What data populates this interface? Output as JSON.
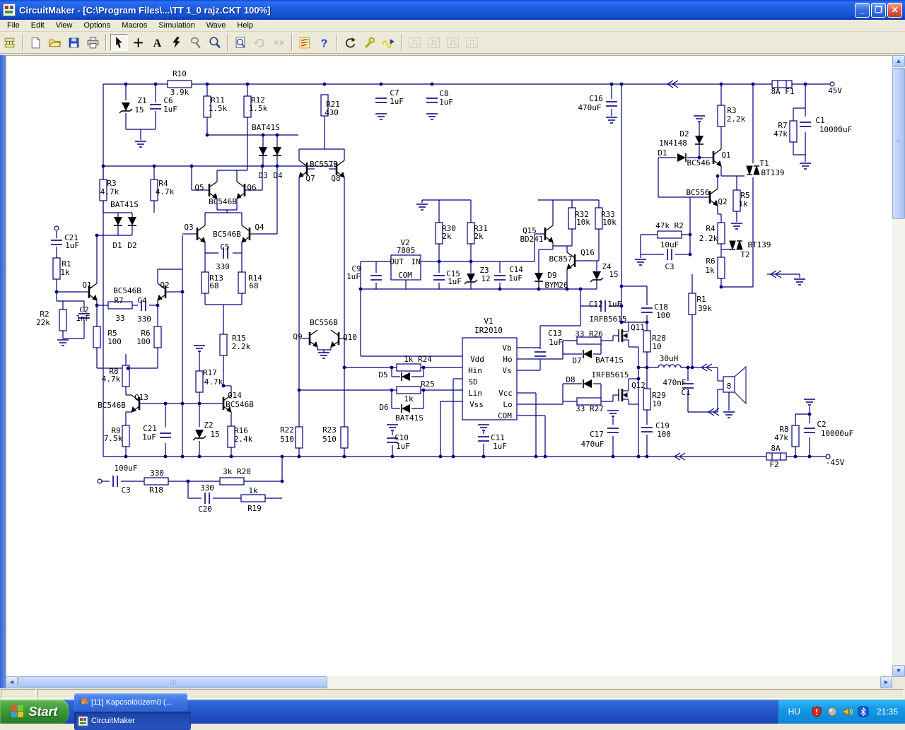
{
  "window": {
    "title": "CircuitMaker - [C:\\Program Files\\...\\TT 1_0  rajz.CKT 100%]"
  },
  "titlebar": {
    "minimize": "minimize-button",
    "restore": "restore-button",
    "close": "close-button"
  },
  "menu": {
    "items": [
      "File",
      "Edit",
      "View",
      "Options",
      "Macros",
      "Simulation",
      "Wave",
      "Help"
    ]
  },
  "toolbar": {
    "groups": [
      [
        {
          "n": "parts-bin"
        }
      ],
      [
        {
          "n": "new"
        },
        {
          "n": "open"
        },
        {
          "n": "save"
        },
        {
          "n": "print"
        }
      ],
      [
        {
          "n": "select",
          "pressed": true
        },
        {
          "n": "wire"
        },
        {
          "n": "text"
        },
        {
          "n": "delete"
        },
        {
          "n": "probe"
        },
        {
          "n": "zoom"
        }
      ],
      [
        {
          "n": "zoom-window"
        },
        {
          "n": "rotate",
          "disabled": true
        },
        {
          "n": "mirror",
          "disabled": true
        }
      ],
      [
        {
          "n": "simulation-setup"
        },
        {
          "n": "help"
        }
      ],
      [
        {
          "n": "reset"
        },
        {
          "n": "tools"
        },
        {
          "n": "waveforms"
        }
      ],
      [
        {
          "n": "digital-display-1",
          "disabled": true
        },
        {
          "n": "digital-display-2",
          "disabled": true
        },
        {
          "n": "digital-display-3",
          "disabled": true
        },
        {
          "n": "digital-display-4",
          "disabled": true
        }
      ]
    ]
  },
  "schematic": {
    "wire_color": "#00007e",
    "labels": [
      [
        "R10",
        253,
        103
      ],
      [
        "3.9k",
        253,
        129
      ],
      [
        "Z1",
        200,
        141
      ],
      [
        "15",
        196,
        154
      ],
      [
        "C6",
        237,
        141
      ],
      [
        "1uF",
        240,
        153
      ],
      [
        "R11",
        307,
        140
      ],
      [
        "1.5k",
        307,
        152
      ],
      [
        "R12",
        364,
        140
      ],
      [
        "1.5k",
        364,
        152
      ],
      [
        "BAT41S",
        375,
        179
      ],
      [
        "D3",
        371,
        247
      ],
      [
        "D4",
        392,
        247
      ],
      [
        "BC557B",
        457,
        231
      ],
      [
        "Q7",
        438,
        251
      ],
      [
        "Q8",
        474,
        251
      ],
      [
        "R21",
        470,
        146
      ],
      [
        "430",
        468,
        158
      ],
      [
        "C7",
        557,
        130
      ],
      [
        "1uF",
        560,
        142
      ],
      [
        "C8",
        627,
        131
      ],
      [
        "1uF",
        630,
        143
      ],
      [
        "C16",
        842,
        138
      ],
      [
        "470uF",
        833,
        151
      ],
      [
        "8A F1",
        1106,
        128
      ],
      [
        "45V",
        1180,
        127
      ],
      [
        "R3",
        1034,
        155
      ],
      [
        "2.2k",
        1040,
        167
      ],
      [
        "R7",
        1106,
        176
      ],
      [
        "47k",
        1103,
        188
      ],
      [
        "C1",
        1159,
        169
      ],
      [
        "10000uF",
        1181,
        182
      ],
      [
        "D2",
        967,
        188
      ],
      [
        "1N4148",
        951,
        201
      ],
      [
        "D1",
        936,
        215
      ],
      [
        "Q1",
        1026,
        218
      ],
      [
        "BC546",
        987,
        229
      ],
      [
        "T1",
        1080,
        230
      ],
      [
        "BT139",
        1092,
        243
      ],
      [
        "BC556",
        986,
        271
      ],
      [
        "Q2",
        1021,
        284
      ],
      [
        "R5",
        1053,
        275
      ],
      [
        "1k",
        1050,
        287
      ],
      [
        "47k R2",
        946,
        318
      ],
      [
        "10uF",
        946,
        345
      ],
      [
        "C3",
        946,
        376
      ],
      [
        "R4",
        1004,
        322
      ],
      [
        "2.2k",
        1001,
        336
      ],
      [
        "R6",
        1004,
        368
      ],
      [
        "1k",
        1003,
        381
      ],
      [
        "BT139",
        1073,
        345
      ],
      [
        "T2",
        1053,
        359
      ],
      [
        "R32",
        822,
        302
      ],
      [
        "10k",
        824,
        313
      ],
      [
        "R33",
        859,
        302
      ],
      [
        "10k",
        861,
        313
      ],
      [
        "Q15",
        748,
        325
      ],
      [
        "BD241",
        751,
        337
      ],
      [
        "BC857",
        792,
        365
      ],
      [
        "Q16",
        830,
        356
      ],
      [
        "Z4",
        857,
        376
      ],
      [
        "15",
        867,
        387
      ],
      [
        "D9",
        780,
        388
      ],
      [
        "BYM26",
        786,
        402
      ],
      [
        "V2",
        572,
        342
      ],
      [
        "7805",
        573,
        353
      ],
      [
        "OUT",
        560,
        369
      ],
      [
        "IN",
        587,
        369
      ],
      [
        "COM",
        572,
        388
      ],
      [
        "C9",
        503,
        379
      ],
      [
        "1uF",
        499,
        390
      ],
      [
        "R30",
        634,
        322
      ],
      [
        "2k",
        631,
        333
      ],
      [
        "R31",
        679,
        322
      ],
      [
        "2k",
        676,
        333
      ],
      [
        "C15",
        640,
        386
      ],
      [
        "1uF",
        642,
        397
      ],
      [
        "Z3",
        684,
        381
      ],
      [
        "12",
        686,
        393
      ],
      [
        "C14",
        729,
        380
      ],
      [
        "1uF",
        728,
        392
      ],
      [
        "C12 1uF",
        855,
        429
      ],
      [
        "V1",
        690,
        453
      ],
      [
        "IR2010",
        690,
        466
      ],
      [
        "Vdd",
        674,
        507
      ],
      [
        "Hin",
        671,
        523
      ],
      [
        "SD",
        668,
        539
      ],
      [
        "Lin",
        671,
        555
      ],
      [
        "Vss",
        673,
        571
      ],
      [
        "Vb",
        716,
        491
      ],
      [
        "Ho",
        717,
        507
      ],
      [
        "Vs",
        716,
        523
      ],
      [
        "Vcc",
        714,
        555
      ],
      [
        "Lo",
        717,
        571
      ],
      [
        "COM",
        713,
        587
      ],
      [
        "1k R24",
        590,
        507
      ],
      [
        "D5",
        541,
        529
      ],
      [
        "R25",
        604,
        542
      ],
      [
        "1k",
        577,
        563
      ],
      [
        "D6",
        542,
        575
      ],
      [
        "BAT41S",
        578,
        590
      ],
      [
        "C10",
        567,
        618
      ],
      [
        "1uF",
        569,
        630
      ],
      [
        "C11",
        703,
        618
      ],
      [
        "1uF",
        706,
        630
      ],
      [
        "C13",
        784,
        470
      ],
      [
        "1uF",
        785,
        483
      ],
      [
        "IRFB5615",
        859,
        450
      ],
      [
        "Q11",
        901,
        462
      ],
      [
        "33 R26",
        832,
        471
      ],
      [
        "D7",
        815,
        509
      ],
      [
        "BAT41S",
        861,
        508
      ],
      [
        "C18",
        934,
        433
      ],
      [
        "100",
        937,
        445
      ],
      [
        "R28",
        931,
        477
      ],
      [
        "10",
        928,
        489
      ],
      [
        "R1",
        991,
        422
      ],
      [
        "39k",
        996,
        435
      ],
      [
        "30uH",
        945,
        506
      ],
      [
        "470nF",
        953,
        540
      ],
      [
        "C1",
        969,
        554
      ],
      [
        "8",
        1030,
        545
      ],
      [
        "D8",
        806,
        536
      ],
      [
        "IRFB5615",
        862,
        529
      ],
      [
        "Q12",
        902,
        544
      ],
      [
        "33 R27",
        833,
        577
      ],
      [
        "R29",
        931,
        558
      ],
      [
        "10",
        928,
        570
      ],
      [
        "C19",
        936,
        601
      ],
      [
        "100",
        938,
        613
      ],
      [
        "C17",
        843,
        613
      ],
      [
        "470uF",
        837,
        627
      ],
      [
        "BC556B",
        457,
        455
      ],
      [
        "Q9",
        420,
        475
      ],
      [
        "Q10",
        494,
        476
      ],
      [
        "R22",
        405,
        607
      ],
      [
        "510",
        405,
        620
      ],
      [
        "R23",
        465,
        607
      ],
      [
        "510",
        465,
        620
      ],
      [
        "C21",
        100,
        335
      ],
      [
        "1uF",
        101,
        346
      ],
      [
        "R1",
        93,
        372
      ],
      [
        "1k",
        91,
        384
      ],
      [
        "Q1",
        122,
        402
      ],
      [
        "BC546B",
        179,
        410
      ],
      [
        "Q2",
        232,
        402
      ],
      [
        "R2",
        62,
        443
      ],
      [
        "22k",
        60,
        455
      ],
      [
        "C2",
        118,
        437
      ],
      [
        "1nF",
        116,
        449
      ],
      [
        "R7",
        167,
        424
      ],
      [
        "33",
        169,
        449
      ],
      [
        "C4",
        200,
        424
      ],
      [
        "330",
        203,
        450
      ],
      [
        "R5",
        158,
        470
      ],
      [
        "100",
        161,
        482
      ],
      [
        "R6",
        205,
        470
      ],
      [
        "100",
        202,
        482
      ],
      [
        "BAT41S",
        175,
        288
      ],
      [
        "D1",
        165,
        346
      ],
      [
        "D2",
        186,
        346
      ],
      [
        "R3",
        157,
        258
      ],
      [
        "4.7k",
        154,
        270
      ],
      [
        "R4",
        230,
        258
      ],
      [
        "4.7k",
        232,
        270
      ],
      [
        "Q5",
        281,
        264
      ],
      [
        "Q6",
        355,
        264
      ],
      [
        "BC546B",
        314,
        284
      ],
      [
        "Q3",
        266,
        320
      ],
      [
        "Q4",
        366,
        320
      ],
      [
        "BC546B",
        320,
        330
      ],
      [
        "C5",
        317,
        348
      ],
      [
        "330",
        314,
        376
      ],
      [
        "R13",
        305,
        392
      ],
      [
        "68",
        302,
        403
      ],
      [
        "R14",
        360,
        392
      ],
      [
        "68",
        358,
        403
      ],
      [
        "R15",
        337,
        477
      ],
      [
        "2.2k",
        340,
        489
      ],
      [
        "R8",
        160,
        524
      ],
      [
        "4.7k",
        156,
        535
      ],
      [
        "Q13",
        199,
        561
      ],
      [
        "BC546B",
        157,
        572
      ],
      [
        "R9",
        163,
        608
      ],
      [
        "7.5k",
        159,
        619
      ],
      [
        "C21",
        211,
        605
      ],
      [
        "1uF",
        210,
        617
      ],
      [
        "R17",
        296,
        526
      ],
      [
        "4.7k",
        301,
        539
      ],
      [
        "Q14",
        331,
        558
      ],
      [
        "BC546B",
        338,
        571
      ],
      [
        "Z2",
        294,
        600
      ],
      [
        "15",
        303,
        613
      ],
      [
        "R16",
        340,
        608
      ],
      [
        "2.4k",
        343,
        620
      ],
      [
        "100uF",
        177,
        661
      ],
      [
        "C3",
        177,
        692
      ],
      [
        "330",
        221,
        668
      ],
      [
        "R18",
        220,
        692
      ],
      [
        "3k R20",
        334,
        666
      ],
      [
        "330",
        292,
        689
      ],
      [
        "C20",
        289,
        719
      ],
      [
        "1k",
        357,
        693
      ],
      [
        "R19",
        359,
        718
      ],
      [
        "R8",
        1108,
        606
      ],
      [
        "47k",
        1104,
        618
      ],
      [
        "C2",
        1161,
        599
      ],
      [
        "10000uF",
        1183,
        612
      ],
      [
        "8A",
        1096,
        633
      ],
      [
        "F2",
        1094,
        656
      ],
      [
        "-45V",
        1180,
        653
      ]
    ]
  },
  "statusbar": {
    "left": "",
    "main": ""
  },
  "taskbar": {
    "start_label": "Start",
    "tasks": [
      {
        "icon": "firefox-icon",
        "label": "[11] Kapcsolóüzemű (...",
        "active": false
      },
      {
        "icon": "circuitmaker-icon",
        "label": "CircuitMaker",
        "active": true
      }
    ],
    "tray": {
      "language": "HU",
      "icons": [
        "security-shield-icon",
        "volume-ball-icon",
        "speaker-icon",
        "bluetooth-icon"
      ],
      "time": "21:35"
    }
  }
}
